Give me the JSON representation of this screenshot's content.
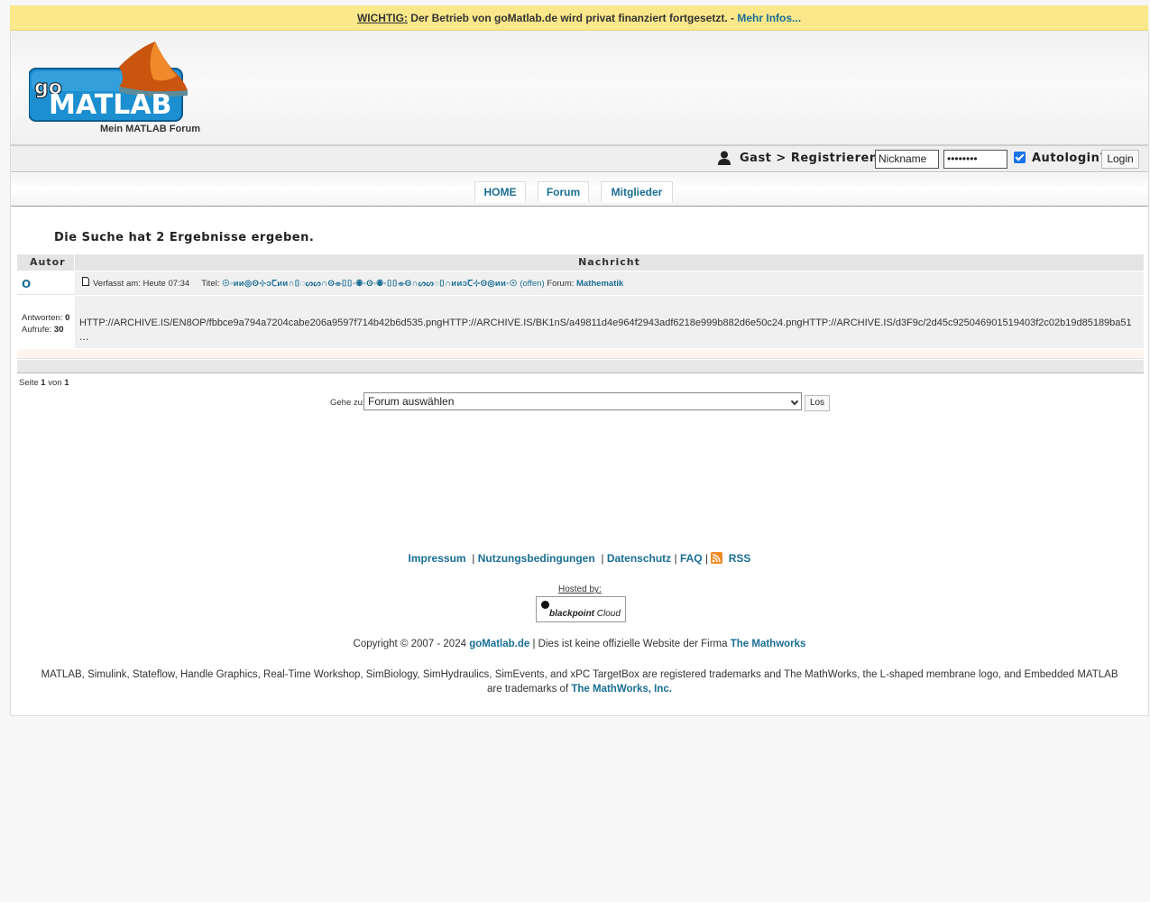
{
  "notice": {
    "label": "WICHTIG:",
    "text": "Der Betrieb von goMatlab.de wird privat finanziert fortgesetzt. -",
    "link": "Mehr Infos..."
  },
  "header": {
    "logo_go": "go",
    "logo_text": "MATLAB",
    "tagline": "Mein MATLAB Forum"
  },
  "login": {
    "guest_text": "Gast >",
    "register_link": "Registrieren",
    "nickname_value": "Nickname",
    "password_value": "••••••••",
    "autologin_label": "Autologin?",
    "login_button": "Login"
  },
  "nav": {
    "tabs": [
      "HOME",
      "Forum",
      "Mitglieder"
    ]
  },
  "search": {
    "result_text": "Die Suche hat 2 Ergebnisse ergeben."
  },
  "table": {
    "headers": [
      "Autor",
      "Nachricht"
    ],
    "rows": [
      {
        "author": "O",
        "posted_label": "Verfasst am:",
        "posted_value": "Heute 07:34",
        "title_label": "Titel:",
        "title_value": "☉◦ᴎᴎ◎ʘ⊹ↄꞆᴎᴎ∩⌷◌ᔕᔕ∩ʘ⌯⌷⌷◦◉◦ʘ◦◉◦⌷⌷⌯ʘ∩ᔕᔕ◌⌷∩ᴎᴎↄꞆ⊹ʘ◎ᴎᴎ◦☉",
        "status": "(offen)",
        "forum_label": "Forum:",
        "forum_value": "Mathematik",
        "replies_label": "Antworten:",
        "replies_value": "0",
        "views_label": "Aufrufe:",
        "views_value": "30",
        "body": "HTTP://ARCHIVE.IS/EN8OP/fbbce9a794a7204cabe206a9597f714b42b6d535.pngHTTP://ARCHIVE.IS/BK1nS/a49811d4e964f2943adf6218e999b882d6e50c24.pngHTTP://ARCHIVE.IS/d3F9c/2d45c925046901519403f2c02b19d85189ba51",
        "ellipsis": "..."
      }
    ]
  },
  "pager": {
    "page_label": "Seite",
    "page_current": "1",
    "page_of": "von",
    "page_total": "1"
  },
  "jump": {
    "label": "Gehe zu:",
    "selected": "Forum auswählen",
    "button": "Los"
  },
  "footer": {
    "links": [
      "Impressum",
      "Nutzungsbedingungen",
      "Datenschutz",
      "FAQ"
    ],
    "rss": "RSS",
    "hosted_by": "Hosted by:",
    "host_name_bold": "blackpoint",
    "host_name_rest": "Cloud",
    "copyright_text": "Copyright © 2007 - 2024",
    "site_link": "goMatlab.de",
    "disclaimer_text": "| Dies ist keine offizielle Website der Firma",
    "company_link": "The Mathworks",
    "trademark_text": "MATLAB, Simulink, Stateflow, Handle Graphics, Real-Time Workshop, SimBiology, SimHydraulics, SimEvents, and xPC TargetBox are registered trademarks and The MathWorks, the L-shaped membrane logo, and Embedded MATLAB are trademarks of",
    "trademark_link": "The MathWorks, Inc."
  },
  "colors": {
    "notice_bg": "#fbe88a",
    "link": "#1a6e94",
    "logo_blue": "#1c8fd1"
  }
}
